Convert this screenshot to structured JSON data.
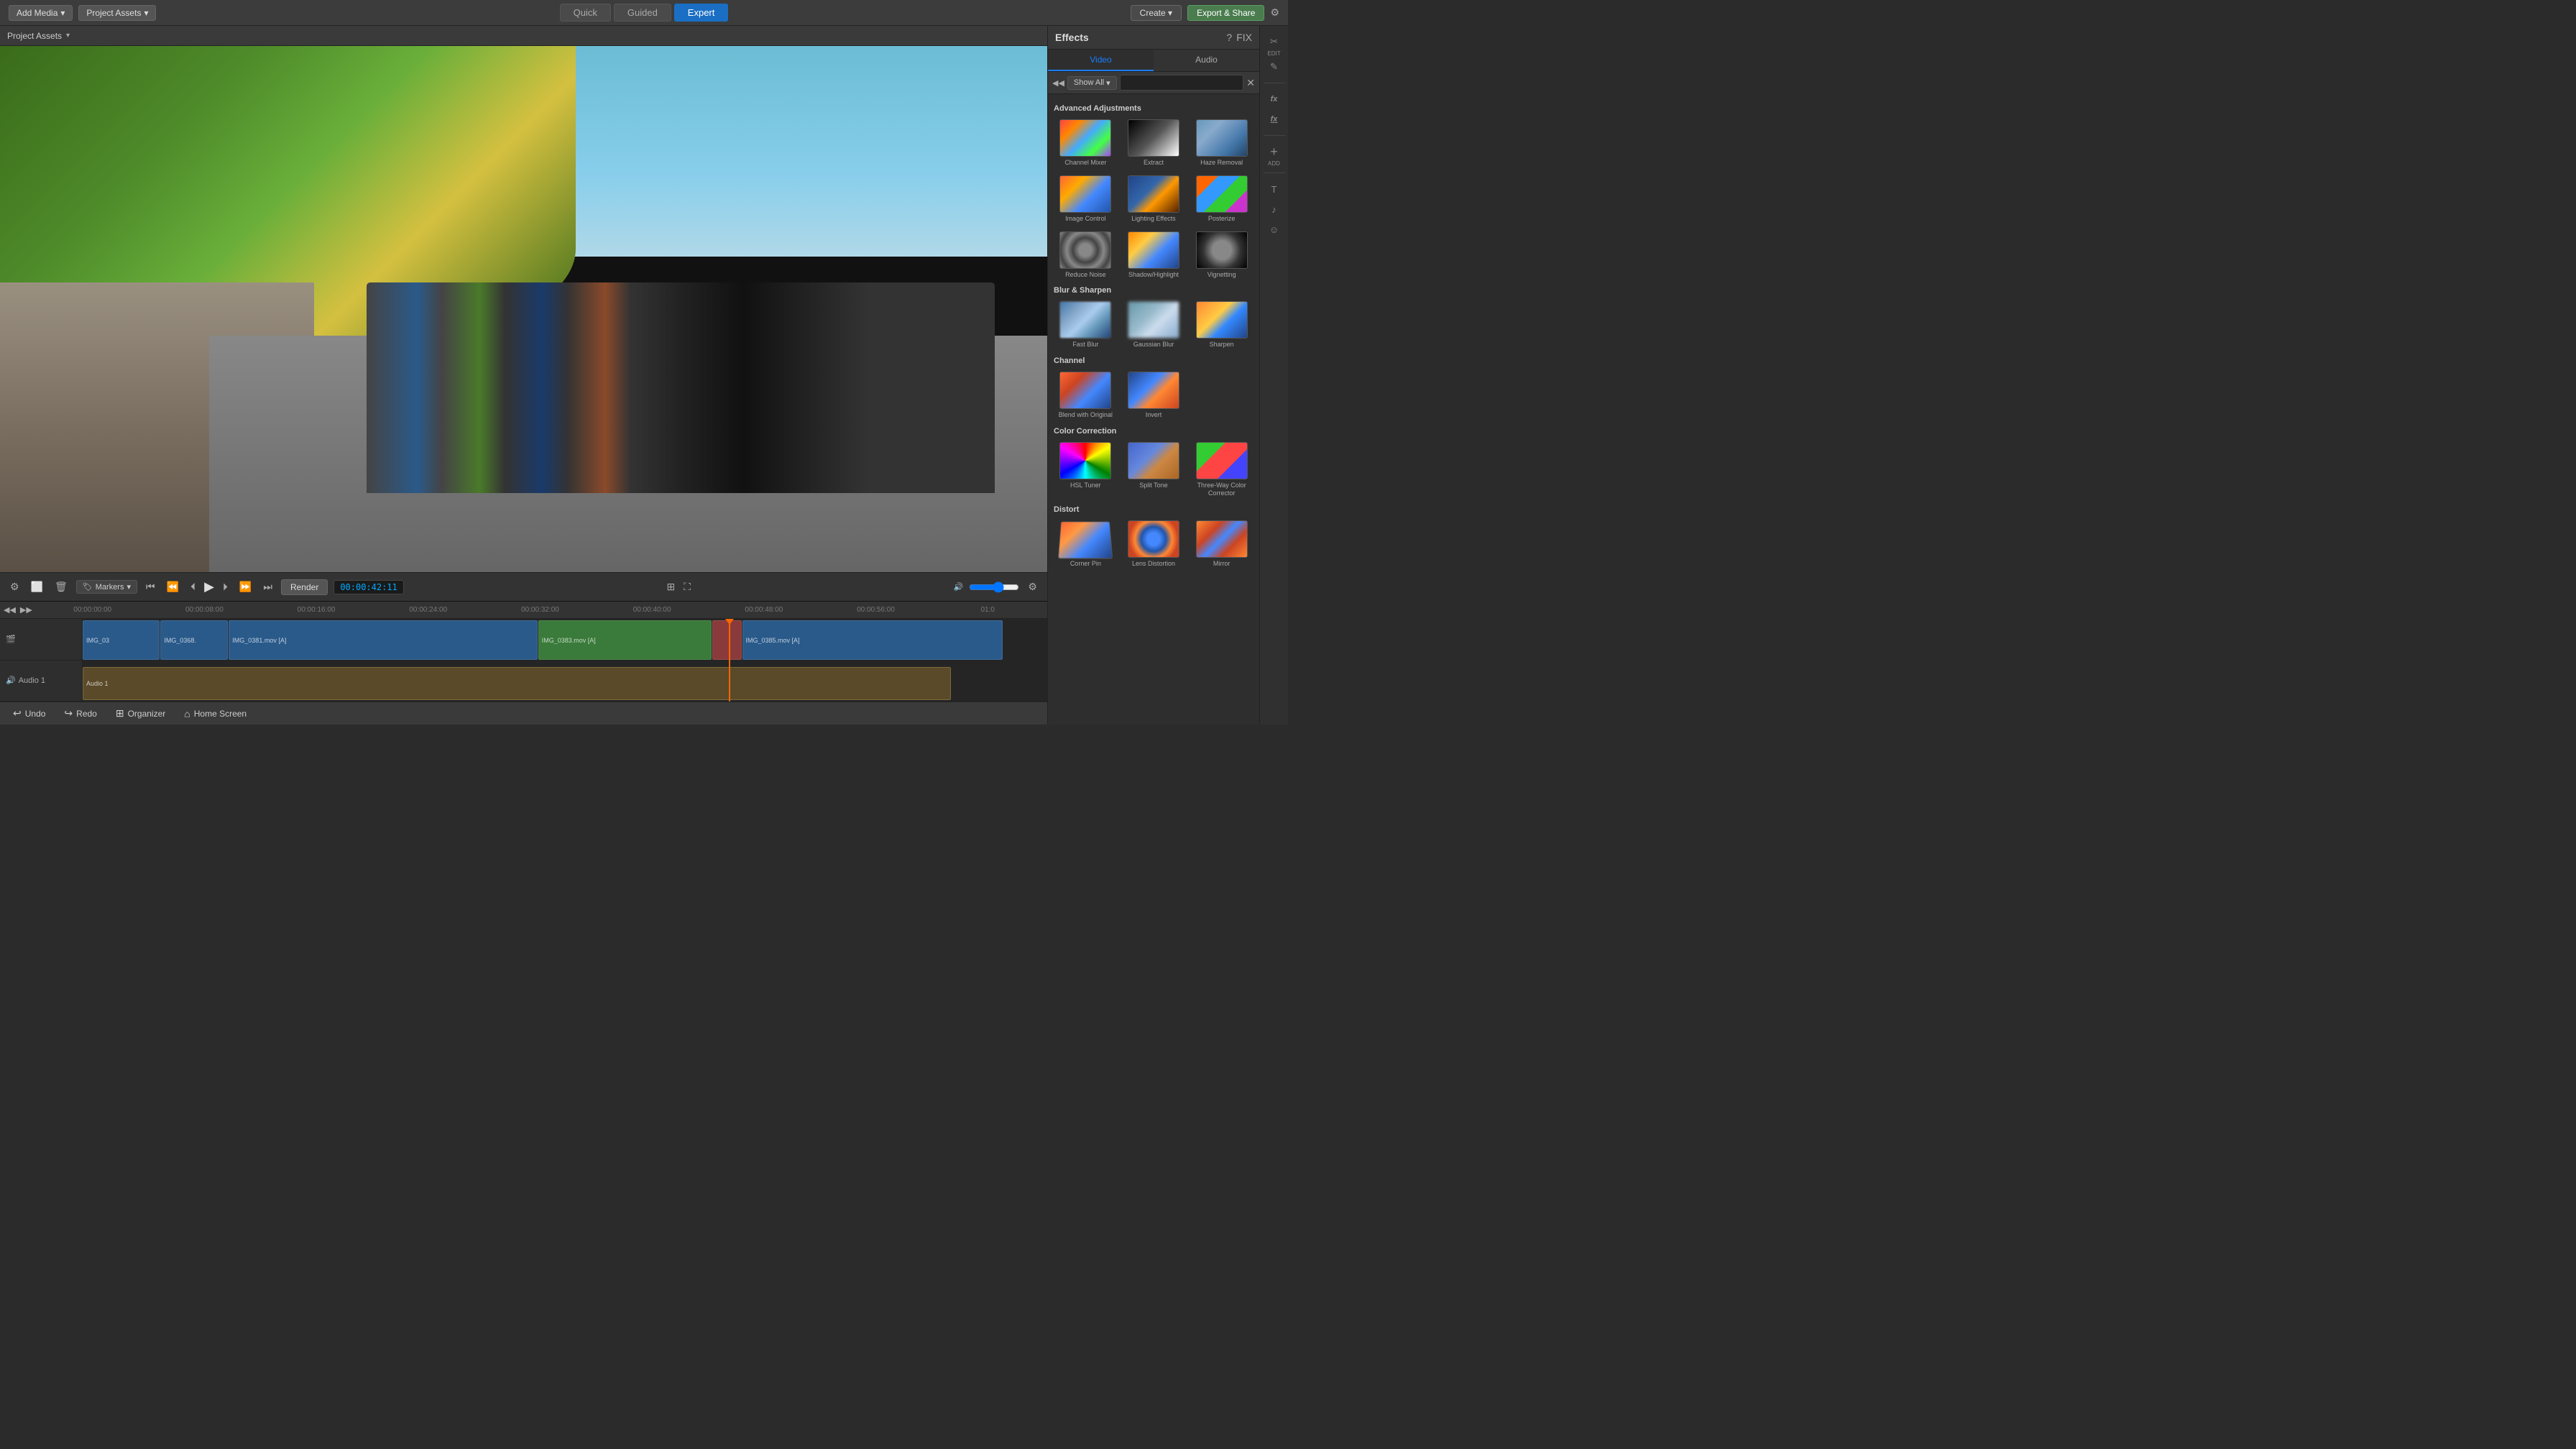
{
  "topbar": {
    "add_media_label": "Add Media",
    "project_assets_label": "Project Assets",
    "mode_quick": "Quick",
    "mode_guided": "Guided",
    "mode_expert": "Expert",
    "create_label": "Create",
    "export_label": "Export & Share",
    "settings_icon": "⚙"
  },
  "timeline": {
    "timecode": "00:00:42:11",
    "markers_label": "Markers",
    "render_label": "Render",
    "marks": [
      "00:00:00:00",
      "00:00:08:00",
      "00:00:16:00",
      "00:00:24:00",
      "00:00:32:00",
      "00:00:40:00",
      "00:00:48:00",
      "00:00:56:00",
      "01:0"
    ]
  },
  "bottombar": {
    "undo_label": "Undo",
    "redo_label": "Redo",
    "organizer_label": "Organizer",
    "home_screen_label": "Home Screen"
  },
  "effects_panel": {
    "title": "Effects",
    "help_icon": "?",
    "fix_label": "FIX",
    "tab_video": "Video",
    "tab_audio": "Audio",
    "show_all_label": "Show All",
    "search_placeholder": "",
    "sections": [
      {
        "name": "Advanced Adjustments",
        "items": [
          {
            "label": "Channel Mixer",
            "thumb_class": "thumb-channel-mixer"
          },
          {
            "label": "Extract",
            "thumb_class": "thumb-extract"
          },
          {
            "label": "Haze Removal",
            "thumb_class": "thumb-haze-removal"
          },
          {
            "label": "Image Control",
            "thumb_class": "thumb-image-control"
          },
          {
            "label": "Lighting Effects",
            "thumb_class": "thumb-lighting-effects"
          },
          {
            "label": "Posterize",
            "thumb_class": "thumb-posterize"
          },
          {
            "label": "Reduce Noise",
            "thumb_class": "thumb-reduce-noise"
          },
          {
            "label": "Shadow/Highlight",
            "thumb_class": "thumb-shadow-highlight"
          },
          {
            "label": "Vignetting",
            "thumb_class": "thumb-vignetting"
          }
        ]
      },
      {
        "name": "Blur & Sharpen",
        "items": [
          {
            "label": "Fast Blur",
            "thumb_class": "thumb-fast-blur"
          },
          {
            "label": "Gaussian Blur",
            "thumb_class": "thumb-gaussian-blur"
          },
          {
            "label": "Sharpen",
            "thumb_class": "thumb-sharpen"
          }
        ]
      },
      {
        "name": "Channel",
        "items": [
          {
            "label": "Blend with Original",
            "thumb_class": "thumb-blend-original"
          },
          {
            "label": "Invert",
            "thumb_class": "thumb-invert"
          }
        ]
      },
      {
        "name": "Color Correction",
        "items": [
          {
            "label": "HSL Tuner",
            "thumb_class": "thumb-hsl-tuner"
          },
          {
            "label": "Split Tone",
            "thumb_class": "thumb-split-tone"
          },
          {
            "label": "Three-Way Color Corrector",
            "thumb_class": "thumb-three-way"
          }
        ]
      },
      {
        "name": "Distort",
        "items": [
          {
            "label": "Corner Pin",
            "thumb_class": "thumb-corner-pin"
          },
          {
            "label": "Lens Distortion",
            "thumb_class": "thumb-lens-distortion"
          },
          {
            "label": "Mirror",
            "thumb_class": "thumb-mirror"
          }
        ]
      }
    ]
  },
  "side_icons": [
    {
      "icon": "✂",
      "label": ""
    },
    {
      "icon": "✎",
      "label": "EDIT"
    },
    {
      "icon": "fx",
      "label": ""
    },
    {
      "icon": "fx",
      "label": ""
    },
    {
      "icon": "+",
      "label": "ADD"
    },
    {
      "icon": "≡",
      "label": ""
    },
    {
      "icon": "♪",
      "label": ""
    },
    {
      "icon": "☺",
      "label": ""
    }
  ],
  "clips": [
    {
      "label": "IMG_03",
      "class": "clip-blue",
      "width": "8%"
    },
    {
      "label": "IMG_0368.",
      "class": "clip-blue",
      "width": "7%"
    },
    {
      "label": "IMG_0381.mov [A]",
      "class": "clip-blue",
      "width": "32%"
    },
    {
      "label": "IMG_0383.mov [A]",
      "class": "clip-green",
      "width": "18%"
    },
    {
      "label": "",
      "class": "clip-red",
      "width": "3%"
    },
    {
      "label": "IMG_0385.mov [A]",
      "class": "clip-blue",
      "width": "27%"
    }
  ],
  "audio_clip": {
    "label": "Audio 1"
  }
}
